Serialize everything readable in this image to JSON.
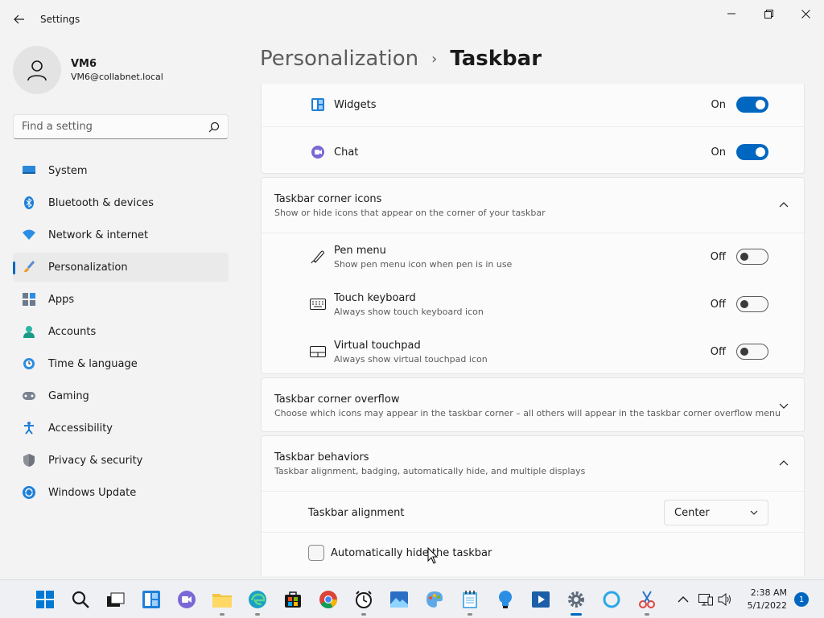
{
  "window": {
    "title": "Settings",
    "back_icon": "back-arrow-icon",
    "controls": [
      "minimize-icon",
      "restore-icon",
      "close-icon"
    ]
  },
  "profile": {
    "name": "VM6",
    "email": "VM6@collabnet.local"
  },
  "search": {
    "placeholder": "Find a setting",
    "value": ""
  },
  "sidebar": {
    "items": [
      {
        "label": "System",
        "icon": "monitor-icon"
      },
      {
        "label": "Bluetooth & devices",
        "icon": "bluetooth-icon"
      },
      {
        "label": "Network & internet",
        "icon": "wifi-icon"
      },
      {
        "label": "Personalization",
        "icon": "brush-icon",
        "active": true
      },
      {
        "label": "Apps",
        "icon": "apps-icon"
      },
      {
        "label": "Accounts",
        "icon": "person-icon"
      },
      {
        "label": "Time & language",
        "icon": "clock-globe-icon"
      },
      {
        "label": "Gaming",
        "icon": "gamepad-icon"
      },
      {
        "label": "Accessibility",
        "icon": "accessibility-icon"
      },
      {
        "label": "Privacy & security",
        "icon": "shield-icon"
      },
      {
        "label": "Windows Update",
        "icon": "update-icon"
      }
    ]
  },
  "breadcrumb": {
    "parent": "Personalization",
    "separator": "›",
    "current": "Taskbar"
  },
  "taskbar_items": {
    "widgets": {
      "label": "Widgets",
      "state": "On"
    },
    "chat": {
      "label": "Chat",
      "state": "On"
    }
  },
  "corner_icons": {
    "title": "Taskbar corner icons",
    "subtitle": "Show or hide icons that appear on the corner of your taskbar",
    "items": [
      {
        "label": "Pen menu",
        "sub": "Show pen menu icon when pen is in use",
        "state": "Off"
      },
      {
        "label": "Touch keyboard",
        "sub": "Always show touch keyboard icon",
        "state": "Off"
      },
      {
        "label": "Virtual touchpad",
        "sub": "Always show virtual touchpad icon",
        "state": "Off"
      }
    ]
  },
  "corner_overflow": {
    "title": "Taskbar corner overflow",
    "subtitle": "Choose which icons may appear in the taskbar corner – all others will appear in the taskbar corner overflow menu"
  },
  "behaviors": {
    "title": "Taskbar behaviors",
    "subtitle": "Taskbar alignment, badging, automatically hide, and multiple displays",
    "alignment_label": "Taskbar alignment",
    "alignment_value": "Center",
    "autohide_label": "Automatically hide the taskbar",
    "autohide_checked": false
  },
  "system_tray": {
    "time": "2:38 AM",
    "date": "5/1/2022",
    "notifications": "1"
  },
  "colors": {
    "accent": "#0067c0"
  }
}
